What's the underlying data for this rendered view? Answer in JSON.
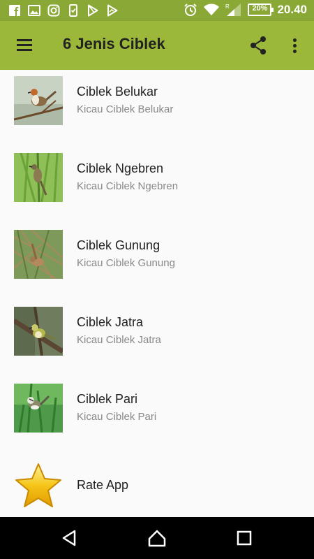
{
  "status_bar": {
    "left_icons": [
      "facebook-icon",
      "gallery-icon",
      "instagram-icon",
      "phone-icon",
      "play-store-icon",
      "play-store-icon"
    ],
    "battery": "20%",
    "time": "20.40",
    "icons": [
      "alarm-icon",
      "wifi-icon",
      "signal-icon",
      "battery-icon"
    ]
  },
  "app_bar": {
    "title": "6 Jenis Ciblek",
    "icons": [
      "menu-icon",
      "share-icon",
      "more-vert-icon"
    ]
  },
  "items": [
    {
      "title": "Ciblek Belukar",
      "subtitle": "Kicau Ciblek Belukar"
    },
    {
      "title": "Ciblek Ngebren",
      "subtitle": "Kicau Ciblek Ngebren"
    },
    {
      "title": "Ciblek Gunung",
      "subtitle": "Kicau Ciblek Gunung"
    },
    {
      "title": "Ciblek Jatra",
      "subtitle": "Kicau Ciblek Jatra"
    },
    {
      "title": "Ciblek Pari",
      "subtitle": "Kicau Ciblek Pari"
    },
    {
      "title": "Rate App",
      "icon": "star-icon"
    }
  ],
  "nav_bar": {
    "icons": [
      "back-icon",
      "home-icon",
      "recents-icon"
    ]
  },
  "colors": {
    "status_bar": "#8aa836",
    "app_bar": "#9bb83a",
    "title_text": "#222222",
    "subtitle_text": "#888888",
    "star": "#f5c518"
  }
}
